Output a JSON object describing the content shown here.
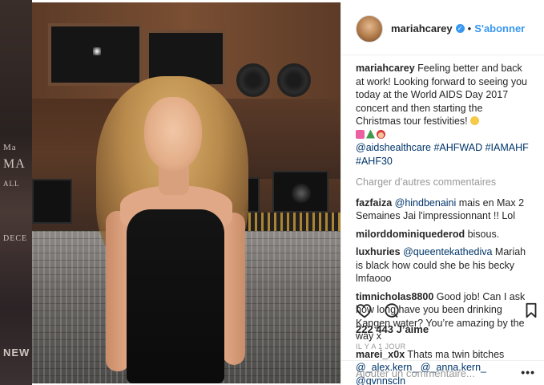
{
  "backdrop": {
    "texts": [
      "Ma",
      "MA",
      "ALL",
      "DECE",
      "NEW"
    ]
  },
  "post": {
    "username": "mariahcarey",
    "verified_icon": "verified-badge-icon",
    "separator": "•",
    "follow_label": "S'abonner",
    "caption": {
      "user": "mariahcarey",
      "text": "Feeling better and back at work! Looking forward to seeing you today at the World AIDS Day 2017 concert and then starting the Christmas tour festivities!",
      "emojis": [
        "hugging-face-emoji",
        "sparkling-heart-emoji",
        "christmas-tree-emoji",
        "santa-emoji"
      ],
      "hashtags": "@aidshealthcare #AHFWAD #IAMAHF #AHF30"
    },
    "load_more_label": "Charger d’autres commentaires",
    "comments": [
      {
        "user": "fazfaiza",
        "mention": "@hindbenaini",
        "text": " mais en Max 2 Semaines Jai l'impressionnant !! Lol"
      },
      {
        "user": "milorddominiquederod",
        "mention": "",
        "text": " bisous."
      },
      {
        "user": "luxhuries",
        "mention": "@queentekathediva",
        "text": " Mariah is black how could she be his becky lmfaooo"
      },
      {
        "user": "timnicholas8800",
        "mention": "",
        "text": " Good job! Can I ask how long have you been drinking Kangen water? You’re amazing by the way x"
      },
      {
        "user": "marei_x0x",
        "mention": "",
        "text": " Thats ma twin bitches ",
        "mentions_after": "@_alex.kern_ @_anna.kern_ @gvnnscln"
      }
    ],
    "actions": {
      "like_icon": "heart-icon",
      "comment_icon": "comment-bubble-icon",
      "save_icon": "bookmark-icon"
    },
    "likes_label": "222 443 J’aime",
    "timestamp": "IL Y A 1 JOUR",
    "add_comment_placeholder": "Ajouter un commentaire...",
    "more_label": "•••"
  },
  "colors": {
    "link_blue": "#3897f0",
    "hashtag_navy": "#003569",
    "muted_gray": "#999999",
    "text": "#262626"
  }
}
